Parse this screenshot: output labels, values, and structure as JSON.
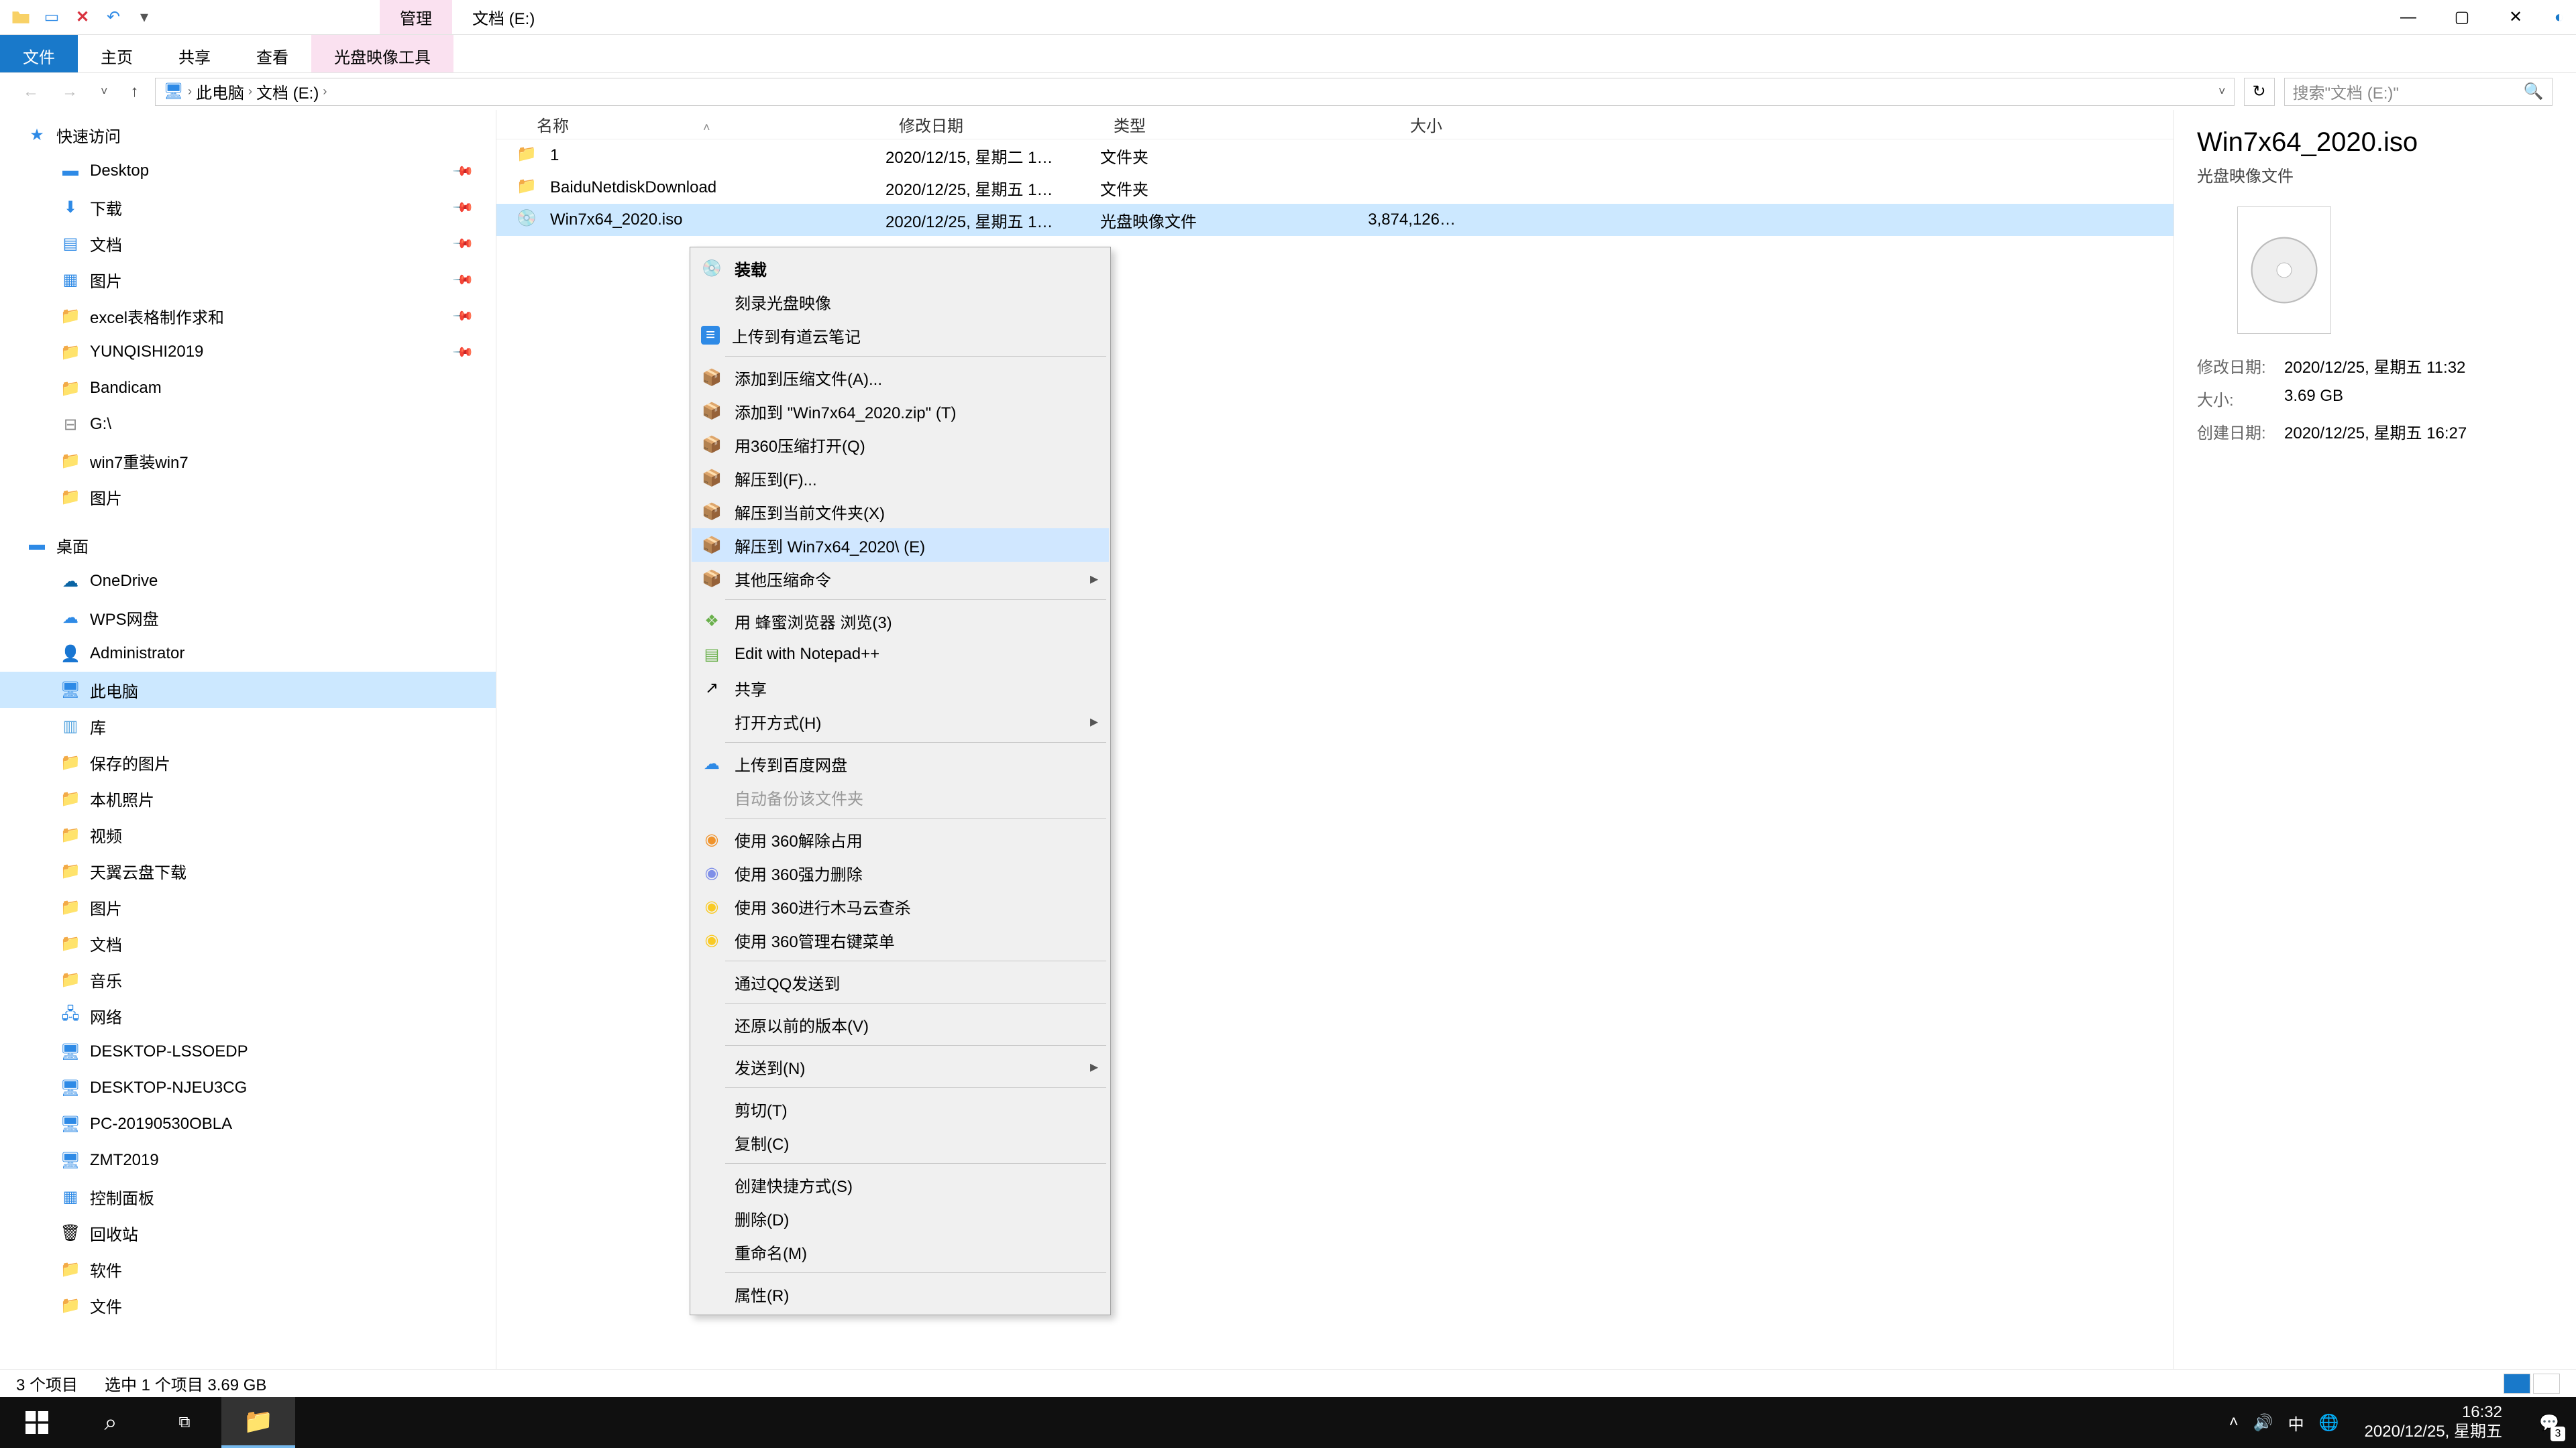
{
  "title_tabs": {
    "manage": "管理",
    "location": "文档 (E:)"
  },
  "ribbon": {
    "file": "文件",
    "home": "主页",
    "share": "共享",
    "view": "查看",
    "tool": "光盘映像工具"
  },
  "breadcrumb": {
    "root": "此电脑",
    "drive": "文档 (E:)"
  },
  "search": {
    "placeholder": "搜索\"文档 (E:)\""
  },
  "columns": {
    "name": "名称",
    "date": "修改日期",
    "type": "类型",
    "size": "大小"
  },
  "rows": [
    {
      "name": "1",
      "date": "2020/12/15, 星期二 1…",
      "type": "文件夹",
      "size": ""
    },
    {
      "name": "BaiduNetdiskDownload",
      "date": "2020/12/25, 星期五 1…",
      "type": "文件夹",
      "size": ""
    },
    {
      "name": "Win7x64_2020.iso",
      "date": "2020/12/25, 星期五 1…",
      "type": "光盘映像文件",
      "size": "3,874,126…"
    }
  ],
  "nav": {
    "quick": "快速访问",
    "quick_items": [
      "Desktop",
      "下载",
      "文档",
      "图片",
      "excel表格制作求和",
      "YUNQISHI2019",
      "Bandicam",
      "G:\\",
      "win7重装win7",
      "图片"
    ],
    "desktop": "桌面",
    "desktop_items": [
      "OneDrive",
      "WPS网盘",
      "Administrator",
      "此电脑",
      "库"
    ],
    "lib_items": [
      "保存的图片",
      "本机照片",
      "视频",
      "天翼云盘下载",
      "图片",
      "文档",
      "音乐"
    ],
    "network": "网络",
    "net_items": [
      "DESKTOP-LSSOEDP",
      "DESKTOP-NJEU3CG",
      "PC-20190530OBLA",
      "ZMT2019"
    ],
    "tail": [
      "控制面板",
      "回收站",
      "软件",
      "文件"
    ]
  },
  "details": {
    "name": "Win7x64_2020.iso",
    "type": "光盘映像文件",
    "mod_label": "修改日期:",
    "mod": "2020/12/25, 星期五 11:32",
    "size_label": "大小:",
    "size": "3.69 GB",
    "create_label": "创建日期:",
    "create": "2020/12/25, 星期五 16:27"
  },
  "status": {
    "count": "3 个项目",
    "sel": "选中 1 个项目  3.69 GB"
  },
  "ctx": {
    "mount": "装载",
    "burn": "刻录光盘映像",
    "youdao": "上传到有道云笔记",
    "addarch": "添加到压缩文件(A)...",
    "addzip": "添加到 \"Win7x64_2020.zip\" (T)",
    "open360": "用360压缩打开(Q)",
    "extract_to": "解压到(F)...",
    "extract_here": "解压到当前文件夹(X)",
    "extract_name": "解压到 Win7x64_2020\\ (E)",
    "other_comp": "其他压缩命令",
    "bee": "用 蜂蜜浏览器 浏览(3)",
    "npp": "Edit with Notepad++",
    "share": "共享",
    "openwith": "打开方式(H)",
    "baidu": "上传到百度网盘",
    "autobak": "自动备份该文件夹",
    "u360_unlock": "使用 360解除占用",
    "u360_del": "使用 360强力删除",
    "u360_scan": "使用 360进行木马云查杀",
    "u360_ctx": "使用 360管理右键菜单",
    "qqsend": "通过QQ发送到",
    "restore": "还原以前的版本(V)",
    "sendto": "发送到(N)",
    "cut": "剪切(T)",
    "copy": "复制(C)",
    "shortcut": "创建快捷方式(S)",
    "delete": "删除(D)",
    "rename": "重命名(M)",
    "props": "属性(R)"
  },
  "taskbar": {
    "ime": "中",
    "time": "16:32",
    "date": "2020/12/25, 星期五",
    "notif_count": "3"
  }
}
